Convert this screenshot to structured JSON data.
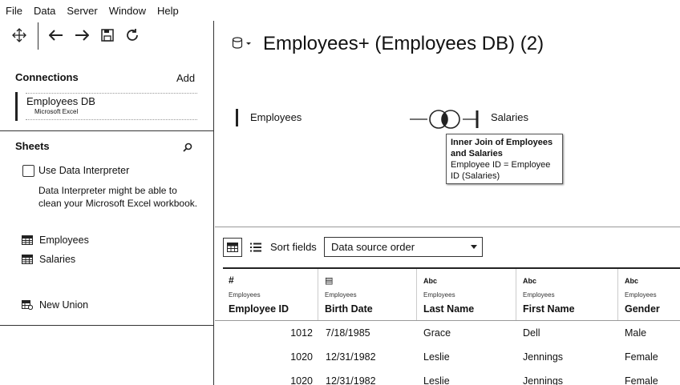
{
  "menu": [
    "File",
    "Data",
    "Server",
    "Window",
    "Help"
  ],
  "connections": {
    "title": "Connections",
    "add_label": "Add",
    "items": [
      {
        "name": "Employees DB",
        "type": "Microsoft Excel"
      }
    ]
  },
  "sheets": {
    "title": "Sheets",
    "use_interpreter_label": "Use Data Interpreter",
    "interpreter_text": "Data Interpreter might be able to clean your Microsoft Excel workbook.",
    "items": [
      "Employees",
      "Salaries"
    ],
    "new_union_label": "New Union"
  },
  "datasource": {
    "title": "Employees+ (Employees DB) (2)",
    "left_table": "Employees",
    "right_table": "Salaries",
    "join_tooltip": {
      "title": "Inner Join of Employees and Salaries",
      "clause": "Employee ID = Employee ID (Salaries)"
    }
  },
  "grid": {
    "sort_label": "Sort fields",
    "sort_value": "Data source order",
    "columns": [
      {
        "type_icon": "#",
        "source": "Employees",
        "name": "Employee ID"
      },
      {
        "type_icon": "▤",
        "source": "Employees",
        "name": "Birth Date"
      },
      {
        "type_icon": "Abc",
        "source": "Employees",
        "name": "Last Name"
      },
      {
        "type_icon": "Abc",
        "source": "Employees",
        "name": "First Name"
      },
      {
        "type_icon": "Abc",
        "source": "Employees",
        "name": "Gender"
      }
    ],
    "rows": [
      [
        "1012",
        "7/18/1985",
        "Grace",
        "Dell",
        "Male"
      ],
      [
        "1020",
        "12/31/1982",
        "Leslie",
        "Jennings",
        "Female"
      ],
      [
        "1020",
        "12/31/1982",
        "Leslie",
        "Jennings",
        "Female"
      ]
    ]
  }
}
